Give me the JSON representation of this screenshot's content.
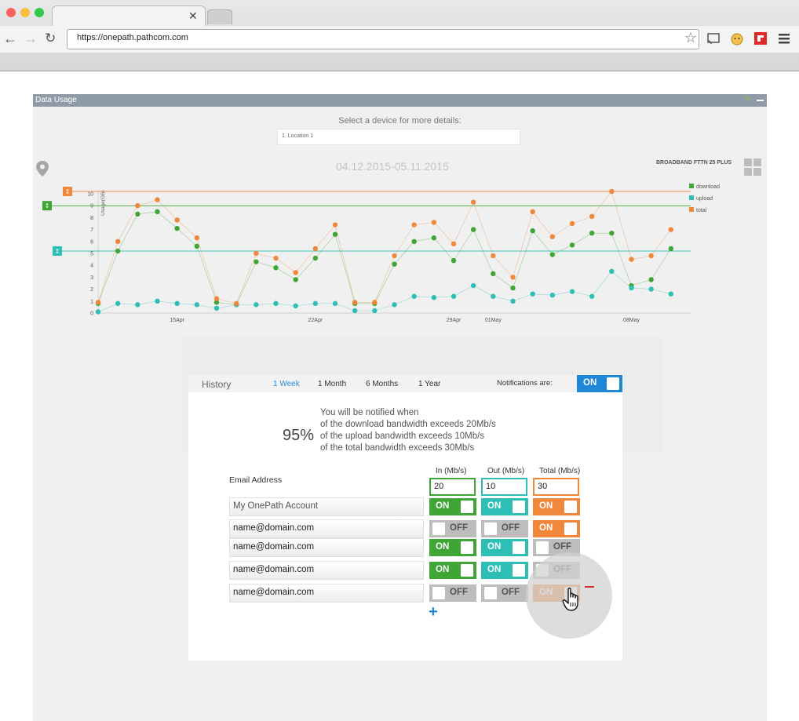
{
  "browser": {
    "url": "https://onepath.pathcom.com"
  },
  "panel": {
    "title": "Data Usage",
    "select_label": "Select a device for more details:",
    "device_value": "1. Location 1",
    "date_range": "04.12.2015-05.11.2015",
    "plan": "BROADBAND FTTN 25 PLUS"
  },
  "chart_data": {
    "type": "line",
    "ylabel": "Usage(GB)",
    "xlabel": "",
    "ylim": [
      0,
      10
    ],
    "yticks": [
      "0",
      "1",
      "2",
      "3",
      "4",
      "5",
      "6",
      "7",
      "8",
      "9",
      "10"
    ],
    "x": [
      "11Apr",
      "12Apr",
      "13Apr",
      "14Apr",
      "15Apr",
      "16Apr",
      "17Apr",
      "18Apr",
      "19Apr",
      "20Apr",
      "21Apr",
      "22Apr",
      "23Apr",
      "24Apr",
      "25Apr",
      "26Apr",
      "27Apr",
      "28Apr",
      "29Apr",
      "30Apr",
      "01May",
      "02May",
      "03May",
      "04May",
      "05May",
      "06May",
      "07May",
      "08May",
      "09May",
      "10May",
      "11May"
    ],
    "xtick_labels": [
      {
        "x": "15Apr",
        "label": "15Apr"
      },
      {
        "x": "22Apr",
        "label": "22Apr"
      },
      {
        "x": "29Apr",
        "label": "29Apr"
      },
      {
        "x": "01May",
        "label": "01May"
      },
      {
        "x": "08May",
        "label": "08May"
      }
    ],
    "series": [
      {
        "name": "download",
        "color": "#3fa535",
        "values": [
          0.8,
          5.2,
          8.3,
          8.5,
          7.1,
          5.6,
          0.9,
          0.7,
          4.3,
          3.8,
          2.8,
          4.6,
          6.6,
          0.8,
          0.8,
          4.1,
          6.0,
          6.3,
          4.4,
          7.0,
          3.3,
          2.1,
          6.9,
          4.9,
          5.7,
          6.7,
          6.7,
          2.3,
          2.8,
          5.4,
          null
        ]
      },
      {
        "name": "upload",
        "color": "#2dbfb5",
        "values": [
          0.1,
          0.8,
          0.7,
          1.0,
          0.8,
          0.7,
          0.4,
          0.7,
          0.7,
          0.8,
          0.6,
          0.8,
          0.8,
          0.2,
          0.2,
          0.7,
          1.4,
          1.3,
          1.4,
          2.3,
          1.4,
          1.0,
          1.6,
          1.5,
          1.8,
          1.4,
          3.5,
          2.1,
          2.0,
          1.6,
          null
        ]
      },
      {
        "name": "total",
        "color": "#f0873a",
        "values": [
          0.9,
          6.0,
          9.0,
          9.5,
          7.8,
          6.3,
          1.2,
          0.8,
          5.0,
          4.6,
          3.4,
          5.4,
          7.4,
          0.9,
          0.9,
          4.8,
          7.4,
          7.6,
          5.8,
          9.3,
          4.8,
          3.0,
          8.5,
          6.4,
          7.5,
          8.1,
          10.2,
          4.5,
          4.8,
          7.0,
          null
        ]
      }
    ],
    "thresholds": [
      {
        "series": "total",
        "value": 10.2,
        "color": "#f0873a"
      },
      {
        "series": "download",
        "value": 9.0,
        "color": "#3fa535"
      },
      {
        "series": "upload",
        "value": 5.2,
        "color": "#2dbfb5"
      }
    ],
    "legend_position": "right"
  },
  "history": {
    "label": "History",
    "tabs": [
      "1 Week",
      "1 Month",
      "6 Months",
      "1 Year"
    ],
    "active_tab": "1 Week",
    "notifications_label": "Notifications are:",
    "notifications_state": "ON",
    "notify_lines": [
      "You will be notified when",
      "of the download bandwidth exceeds 20Mb/s",
      "of the upload bandwidth exceeds 10Mb/s",
      "of the total bandwidth exceeds 30Mb/s"
    ],
    "percent": "95%",
    "email_header": "Email Address",
    "columns": [
      {
        "label": "In (Mb/s)",
        "value": "20",
        "color": "#3fa535"
      },
      {
        "label": "Out (Mb/s)",
        "value": "10",
        "color": "#2dbfb5"
      },
      {
        "label": "Total (Mb/s)",
        "value": "30",
        "color": "#f0873a"
      }
    ],
    "rows": [
      {
        "email": "My OnePath Account",
        "in": "ON",
        "out": "ON",
        "total": "ON"
      },
      {
        "email": "name@domain.com",
        "in": "OFF",
        "out": "OFF",
        "total": "ON"
      },
      {
        "email": "name@domain.com",
        "in": "ON",
        "out": "ON",
        "total": "OFF"
      },
      {
        "email": "name@domain.com",
        "in": "ON",
        "out": "ON",
        "total": "OFF"
      },
      {
        "email": "name@domain.com",
        "in": "OFF",
        "out": "OFF",
        "total": "ON"
      }
    ]
  }
}
